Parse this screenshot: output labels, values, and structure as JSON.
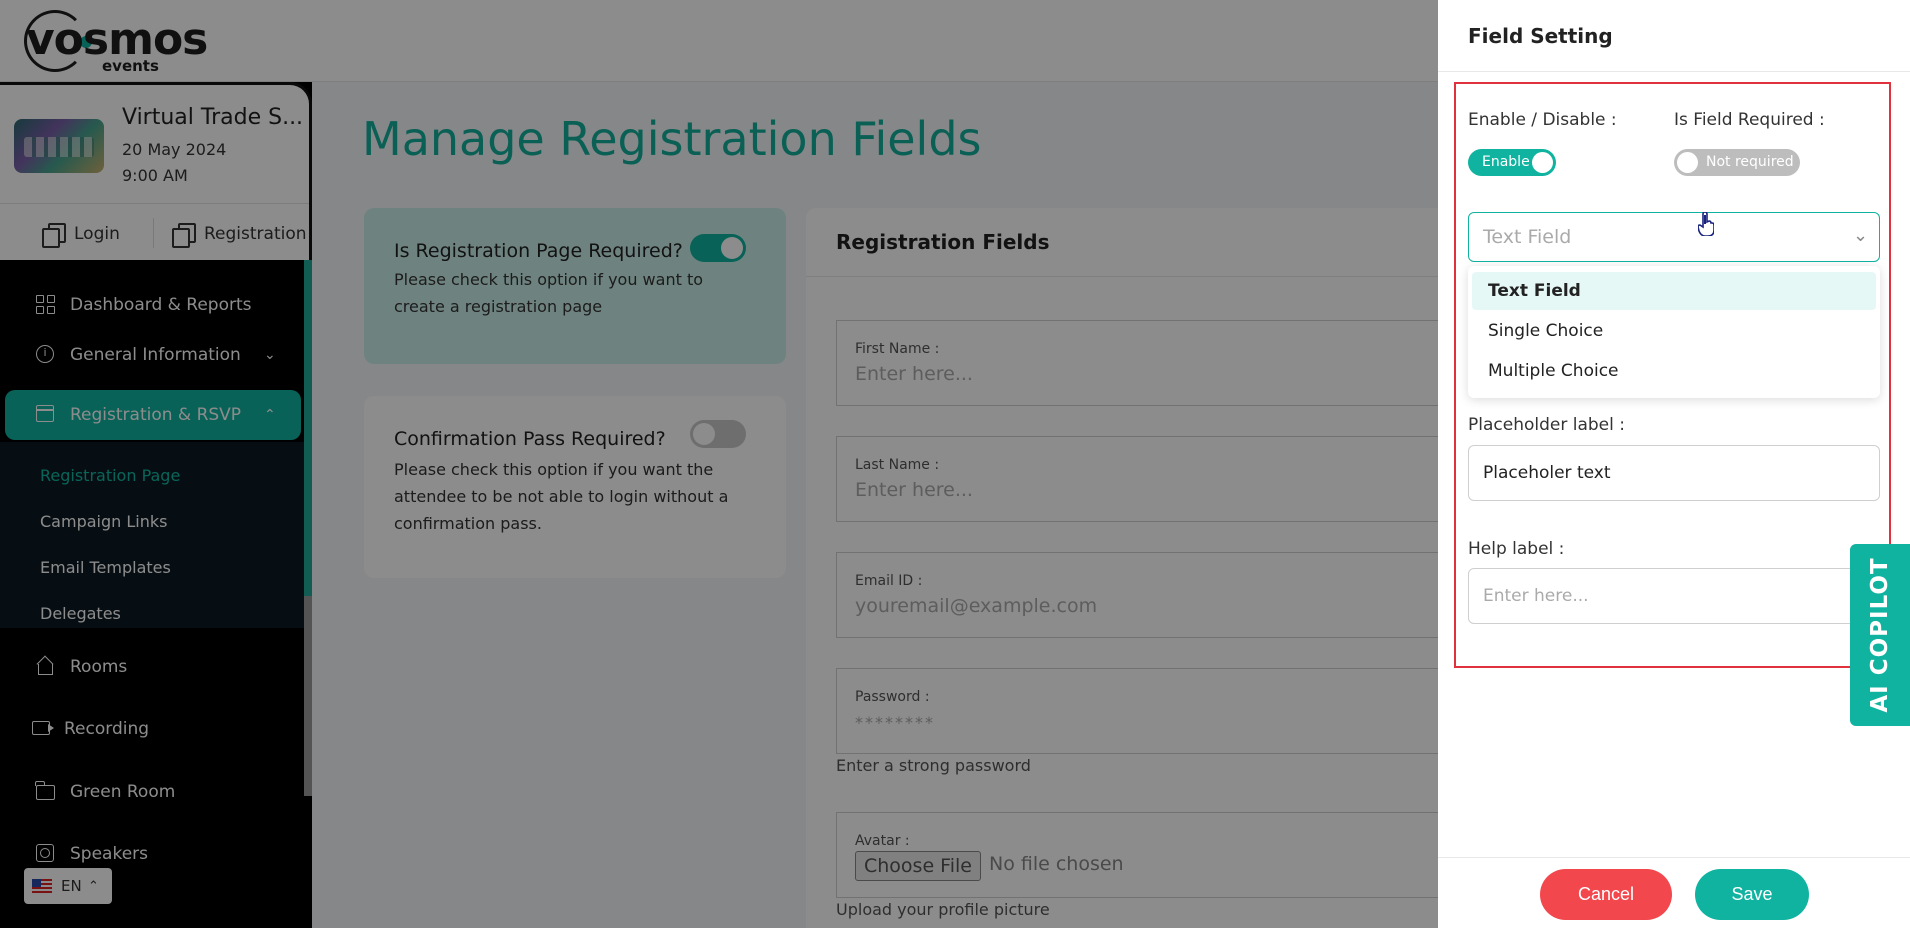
{
  "brand": {
    "logo_text": "vosmos",
    "logo_sub": "events"
  },
  "event": {
    "title": "Virtual Trade S...",
    "date": "20 May 2024",
    "time": "9:00 AM",
    "login_label": "Login",
    "registration_label": "Registration"
  },
  "nav": {
    "dashboard": "Dashboard & Reports",
    "general": "General Information",
    "registration": "Registration & RSVP",
    "sub": [
      "Registration Page",
      "Campaign Links",
      "Email Templates",
      "Delegates"
    ],
    "rooms": "Rooms",
    "recording": "Recording",
    "green_room": "Green Room",
    "speakers": "Speakers"
  },
  "language": {
    "code": "EN"
  },
  "main": {
    "title": "Manage Registration Fields",
    "reg_card": {
      "title": "Is Registration Page Required?",
      "desc": "Please check this option if you want to create a registration page",
      "enabled": true
    },
    "conf_card": {
      "title": "Confirmation Pass Required?",
      "desc": "Please check this option if you want the attendee to be not able to login without a confirmation pass.",
      "enabled": false
    },
    "fields_title": "Registration Fields",
    "fields": [
      {
        "label": "First Name :",
        "placeholder": "Enter here..."
      },
      {
        "label": "Last Name :",
        "placeholder": "Enter here..."
      },
      {
        "label": "Email ID :",
        "placeholder": "youremail@example.com"
      },
      {
        "label": "Password :",
        "placeholder": "********",
        "help": "Enter a strong password"
      },
      {
        "label": "Avatar :",
        "button": "Choose File",
        "status": "No file chosen",
        "help": "Upload your profile picture"
      }
    ]
  },
  "panel": {
    "title": "Field Setting",
    "enable_label": "Enable / Disable :",
    "enable_toggle": "Enable",
    "required_label": "Is Field Required :",
    "required_toggle": "Not required",
    "field_type": {
      "placeholder": "Text Field",
      "options": [
        "Text Field",
        "Single Choice",
        "Multiple Choice"
      ],
      "highlighted": "Text Field"
    },
    "placeholder_label": "Placeholder label :",
    "placeholder_value": "Placeholer text",
    "help_label": "Help label :",
    "help_placeholder": "Enter here...",
    "cancel": "Cancel",
    "save": "Save",
    "copilot": "AI COPILOT"
  },
  "colors": {
    "accent": "#10b3a0",
    "danger": "#f2474d",
    "highlight_frame": "#e0323c"
  }
}
